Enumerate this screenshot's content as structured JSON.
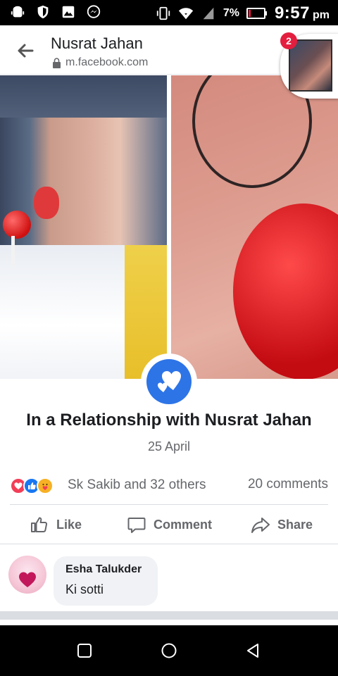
{
  "status_bar": {
    "battery_percent": "7%",
    "time": "9:57",
    "time_suffix": "pm",
    "icons": [
      "android-debug-icon",
      "shield-icon",
      "gallery-icon",
      "messenger-icon",
      "vibrate-icon",
      "wifi-icon",
      "signal-icon",
      "battery-icon"
    ]
  },
  "header": {
    "title": "Nusrat Jahan",
    "url": "m.facebook.com",
    "chat_head_badge": "2"
  },
  "post": {
    "relationship_text": "In a Relationship with Nusrat Jahan",
    "date": "25 April",
    "reactions": [
      "love",
      "like",
      "care"
    ],
    "reaction_names": "Sk Sakib and 32 others",
    "comment_count": "20 comments"
  },
  "actions": {
    "like_label": "Like",
    "comment_label": "Comment",
    "share_label": "Share"
  },
  "comments": [
    {
      "author": "Esha Talukder",
      "text": "Ki sotti"
    }
  ],
  "nav": {
    "buttons": [
      "recent-apps",
      "home",
      "back"
    ]
  },
  "colors": {
    "facebook_blue": "#2d74e7",
    "love_red": "#f33e58",
    "like_blue": "#1877f2",
    "care_yellow": "#f7b125",
    "badge_red": "#e41e3f"
  }
}
